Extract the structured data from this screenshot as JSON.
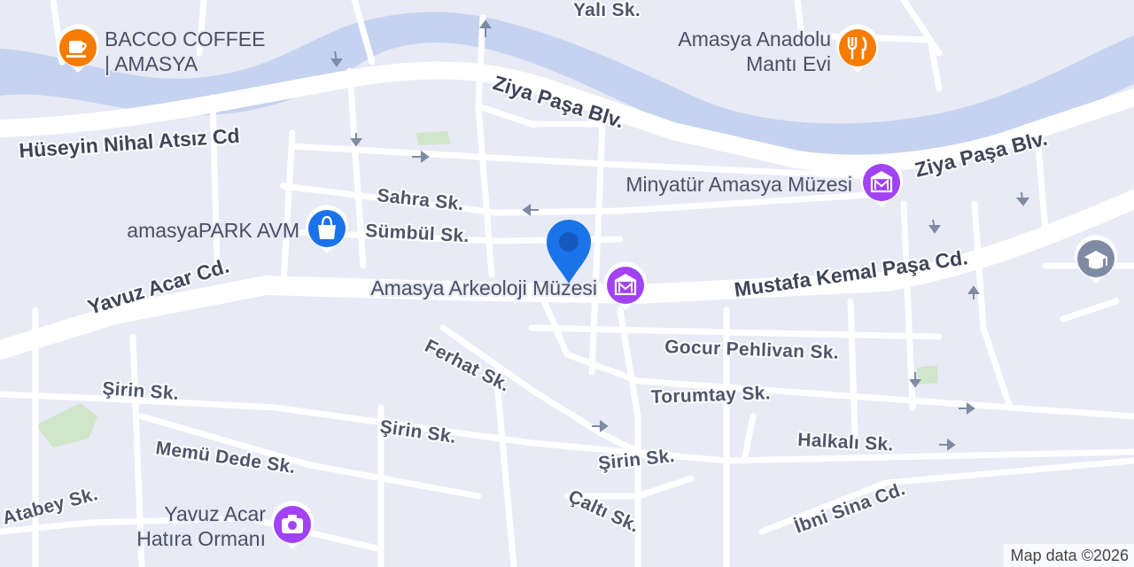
{
  "colors": {
    "land": "#e8eaf6",
    "river": "#c5d3f0",
    "road": "#ffffff",
    "park": "#cfe6c8",
    "pin": "#1a73e8",
    "coffee_poi": "#f57c00",
    "museum_poi": "#a142f4",
    "school_poi": "#7f8ba3"
  },
  "streets": {
    "yali": "Yalı Sk.",
    "ziya_pasa_1": "Ziya Paşa Blv.",
    "ziya_pasa_2": "Ziya Paşa Blv.",
    "huseyin": "Hüseyin Nihal Atsız Cd",
    "sahra": "Sahra Sk.",
    "sumbul": "Sümbül Sk.",
    "yavuz_acar": "Yavuz Acar Cd.",
    "mustafa_kemal": "Mustafa Kemal Paşa Cd.",
    "ferhat": "Ferhat Sk.",
    "gocur": "Gocur Pehlivan Sk.",
    "torumtay": "Torumtay Sk.",
    "sirin_1": "Şirin Sk.",
    "sirin_2": "Şirin Sk.",
    "sirin_3": "Şirin Sk.",
    "memu_dede": "Memü Dede Sk.",
    "halkali": "Halkalı Sk.",
    "atabey": "Atabey Sk.",
    "ibni_sina": "İbni Sina Cd.",
    "calti": "Çaltı Sk."
  },
  "pois": {
    "bacco_line1": "BACCO COFFEE",
    "bacco_line2": "| AMASYA",
    "anadolu_line1": "Amasya Anadolu",
    "anadolu_line2": "Mantı Evi",
    "minyatur": "Minyatür Amasya Müzesi",
    "amasyapark": "amasyaPARK AVM",
    "arkeoloji": "Amasya Arkeoloji Müzesi",
    "yavuz_line1": "Yavuz Acar",
    "yavuz_line2": "Hatıra Ormanı"
  },
  "icons": {
    "coffee": "coffee-cup-icon",
    "restaurant": "fork-knife-icon",
    "museum": "museum-icon",
    "shopping": "shopping-bag-icon",
    "camera": "camera-icon",
    "school": "graduation-cap-icon",
    "pin": "location-pin-icon"
  },
  "attribution": "Map data ©2026"
}
